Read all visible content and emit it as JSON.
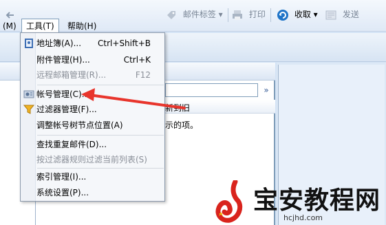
{
  "menubar": {
    "items": [
      {
        "label": "(M)"
      },
      {
        "label": "工具(T)"
      },
      {
        "label": "帮助(H)"
      }
    ]
  },
  "toolbar": {
    "mail_tag": "邮件标签",
    "print": "打印",
    "receive": "收取",
    "send": "发送"
  },
  "list": {
    "column_header": "新到旧",
    "empty_text": "示的项。"
  },
  "tools_menu": {
    "items": [
      {
        "label": "地址簿(A)...",
        "shortcut": "Ctrl+Shift+B",
        "icon": "address-book-icon"
      },
      {
        "label": "附件管理(H)...",
        "shortcut": "Ctrl+K"
      },
      {
        "label": "远程邮箱管理(R)...",
        "shortcut": "F12",
        "disabled": true
      },
      {
        "label": "帐号管理(C)...",
        "icon": "account-manager-icon"
      },
      {
        "label": "过滤器管理(F)...",
        "icon": "filter-icon"
      },
      {
        "label": "调整帐号树节点位置(A)"
      },
      {
        "label": "查找重复邮件(D)..."
      },
      {
        "label": "按过滤器规则过滤当前列表(S)",
        "disabled": true
      },
      {
        "label": "索引管理(I)..."
      },
      {
        "label": "系统设置(P)..."
      }
    ]
  },
  "watermark": {
    "title": "宝安教程网",
    "url": "hcjhd.com"
  },
  "colors": {
    "arrow": "#e8352c",
    "watermark_logo": "#d9241d",
    "toolbar_receive_icon": "#1f74c8"
  }
}
